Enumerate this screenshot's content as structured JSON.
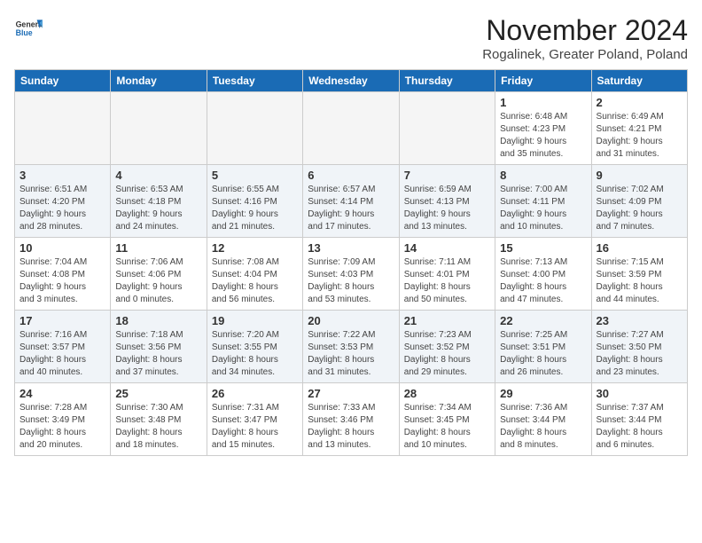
{
  "logo": {
    "general": "General",
    "blue": "Blue"
  },
  "header": {
    "month_title": "November 2024",
    "location": "Rogalinek, Greater Poland, Poland"
  },
  "weekdays": [
    "Sunday",
    "Monday",
    "Tuesday",
    "Wednesday",
    "Thursday",
    "Friday",
    "Saturday"
  ],
  "rows": [
    {
      "days": [
        {
          "num": "",
          "info": "",
          "empty": true
        },
        {
          "num": "",
          "info": "",
          "empty": true
        },
        {
          "num": "",
          "info": "",
          "empty": true
        },
        {
          "num": "",
          "info": "",
          "empty": true
        },
        {
          "num": "",
          "info": "",
          "empty": true
        },
        {
          "num": "1",
          "info": "Sunrise: 6:48 AM\nSunset: 4:23 PM\nDaylight: 9 hours\nand 35 minutes.",
          "empty": false
        },
        {
          "num": "2",
          "info": "Sunrise: 6:49 AM\nSunset: 4:21 PM\nDaylight: 9 hours\nand 31 minutes.",
          "empty": false
        }
      ]
    },
    {
      "days": [
        {
          "num": "3",
          "info": "Sunrise: 6:51 AM\nSunset: 4:20 PM\nDaylight: 9 hours\nand 28 minutes.",
          "empty": false
        },
        {
          "num": "4",
          "info": "Sunrise: 6:53 AM\nSunset: 4:18 PM\nDaylight: 9 hours\nand 24 minutes.",
          "empty": false
        },
        {
          "num": "5",
          "info": "Sunrise: 6:55 AM\nSunset: 4:16 PM\nDaylight: 9 hours\nand 21 minutes.",
          "empty": false
        },
        {
          "num": "6",
          "info": "Sunrise: 6:57 AM\nSunset: 4:14 PM\nDaylight: 9 hours\nand 17 minutes.",
          "empty": false
        },
        {
          "num": "7",
          "info": "Sunrise: 6:59 AM\nSunset: 4:13 PM\nDaylight: 9 hours\nand 13 minutes.",
          "empty": false
        },
        {
          "num": "8",
          "info": "Sunrise: 7:00 AM\nSunset: 4:11 PM\nDaylight: 9 hours\nand 10 minutes.",
          "empty": false
        },
        {
          "num": "9",
          "info": "Sunrise: 7:02 AM\nSunset: 4:09 PM\nDaylight: 9 hours\nand 7 minutes.",
          "empty": false
        }
      ]
    },
    {
      "days": [
        {
          "num": "10",
          "info": "Sunrise: 7:04 AM\nSunset: 4:08 PM\nDaylight: 9 hours\nand 3 minutes.",
          "empty": false
        },
        {
          "num": "11",
          "info": "Sunrise: 7:06 AM\nSunset: 4:06 PM\nDaylight: 9 hours\nand 0 minutes.",
          "empty": false
        },
        {
          "num": "12",
          "info": "Sunrise: 7:08 AM\nSunset: 4:04 PM\nDaylight: 8 hours\nand 56 minutes.",
          "empty": false
        },
        {
          "num": "13",
          "info": "Sunrise: 7:09 AM\nSunset: 4:03 PM\nDaylight: 8 hours\nand 53 minutes.",
          "empty": false
        },
        {
          "num": "14",
          "info": "Sunrise: 7:11 AM\nSunset: 4:01 PM\nDaylight: 8 hours\nand 50 minutes.",
          "empty": false
        },
        {
          "num": "15",
          "info": "Sunrise: 7:13 AM\nSunset: 4:00 PM\nDaylight: 8 hours\nand 47 minutes.",
          "empty": false
        },
        {
          "num": "16",
          "info": "Sunrise: 7:15 AM\nSunset: 3:59 PM\nDaylight: 8 hours\nand 44 minutes.",
          "empty": false
        }
      ]
    },
    {
      "days": [
        {
          "num": "17",
          "info": "Sunrise: 7:16 AM\nSunset: 3:57 PM\nDaylight: 8 hours\nand 40 minutes.",
          "empty": false
        },
        {
          "num": "18",
          "info": "Sunrise: 7:18 AM\nSunset: 3:56 PM\nDaylight: 8 hours\nand 37 minutes.",
          "empty": false
        },
        {
          "num": "19",
          "info": "Sunrise: 7:20 AM\nSunset: 3:55 PM\nDaylight: 8 hours\nand 34 minutes.",
          "empty": false
        },
        {
          "num": "20",
          "info": "Sunrise: 7:22 AM\nSunset: 3:53 PM\nDaylight: 8 hours\nand 31 minutes.",
          "empty": false
        },
        {
          "num": "21",
          "info": "Sunrise: 7:23 AM\nSunset: 3:52 PM\nDaylight: 8 hours\nand 29 minutes.",
          "empty": false
        },
        {
          "num": "22",
          "info": "Sunrise: 7:25 AM\nSunset: 3:51 PM\nDaylight: 8 hours\nand 26 minutes.",
          "empty": false
        },
        {
          "num": "23",
          "info": "Sunrise: 7:27 AM\nSunset: 3:50 PM\nDaylight: 8 hours\nand 23 minutes.",
          "empty": false
        }
      ]
    },
    {
      "days": [
        {
          "num": "24",
          "info": "Sunrise: 7:28 AM\nSunset: 3:49 PM\nDaylight: 8 hours\nand 20 minutes.",
          "empty": false
        },
        {
          "num": "25",
          "info": "Sunrise: 7:30 AM\nSunset: 3:48 PM\nDaylight: 8 hours\nand 18 minutes.",
          "empty": false
        },
        {
          "num": "26",
          "info": "Sunrise: 7:31 AM\nSunset: 3:47 PM\nDaylight: 8 hours\nand 15 minutes.",
          "empty": false
        },
        {
          "num": "27",
          "info": "Sunrise: 7:33 AM\nSunset: 3:46 PM\nDaylight: 8 hours\nand 13 minutes.",
          "empty": false
        },
        {
          "num": "28",
          "info": "Sunrise: 7:34 AM\nSunset: 3:45 PM\nDaylight: 8 hours\nand 10 minutes.",
          "empty": false
        },
        {
          "num": "29",
          "info": "Sunrise: 7:36 AM\nSunset: 3:44 PM\nDaylight: 8 hours\nand 8 minutes.",
          "empty": false
        },
        {
          "num": "30",
          "info": "Sunrise: 7:37 AM\nSunset: 3:44 PM\nDaylight: 8 hours\nand 6 minutes.",
          "empty": false
        }
      ]
    }
  ]
}
